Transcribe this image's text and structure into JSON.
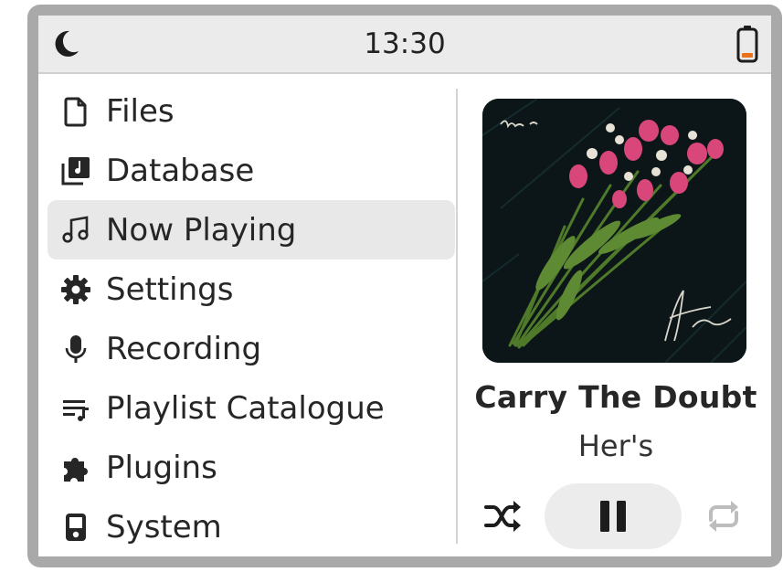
{
  "status": {
    "time": "13:30"
  },
  "menu": {
    "items": [
      {
        "label": "Files",
        "icon": "file-icon"
      },
      {
        "label": "Database",
        "icon": "database-icon"
      },
      {
        "label": "Now Playing",
        "icon": "music-note-icon",
        "active": true
      },
      {
        "label": "Settings",
        "icon": "gear-icon"
      },
      {
        "label": "Recording",
        "icon": "microphone-icon"
      },
      {
        "label": "Playlist Catalogue",
        "icon": "playlist-icon"
      },
      {
        "label": "Plugins",
        "icon": "puzzle-icon"
      },
      {
        "label": "System",
        "icon": "device-icon"
      }
    ]
  },
  "now_playing": {
    "title": "Carry The Doubt",
    "artist": "Her's",
    "playing": true
  },
  "colors": {
    "battery_low": "#e8731a",
    "active_bg": "#e8e8e8",
    "statusbar_bg": "#ebebeb"
  }
}
